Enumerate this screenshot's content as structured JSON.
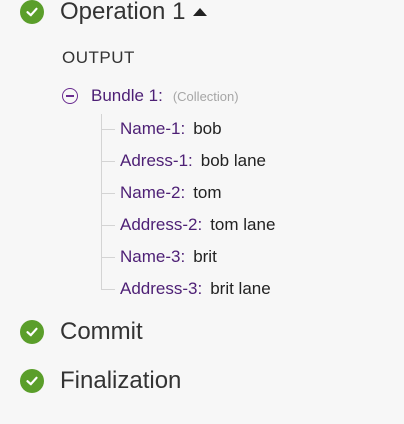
{
  "steps": [
    {
      "title": "Operation 1",
      "status_icon": "check-circle-icon",
      "expanded": true,
      "toggle_icon": "caret-up-icon"
    },
    {
      "title": "Commit",
      "status_icon": "check-circle-icon"
    },
    {
      "title": "Finalization",
      "status_icon": "check-circle-icon"
    }
  ],
  "output": {
    "heading": "OUTPUT",
    "bundle": {
      "label": "Bundle 1:",
      "type": "(Collection)",
      "toggle_icon": "minus-circle-icon",
      "fields": [
        {
          "key": "Name-1:",
          "value": "bob"
        },
        {
          "key": "Adress-1:",
          "value": "bob lane"
        },
        {
          "key": "Name-2:",
          "value": "tom"
        },
        {
          "key": "Address-2:",
          "value": "tom lane"
        },
        {
          "key": "Name-3:",
          "value": "brit"
        },
        {
          "key": "Address-3:",
          "value": "brit lane"
        }
      ]
    }
  },
  "colors": {
    "success": "#5a9e2a",
    "key": "#4d1f75",
    "accent": "#6a2c91",
    "muted": "#a6a6a6"
  }
}
